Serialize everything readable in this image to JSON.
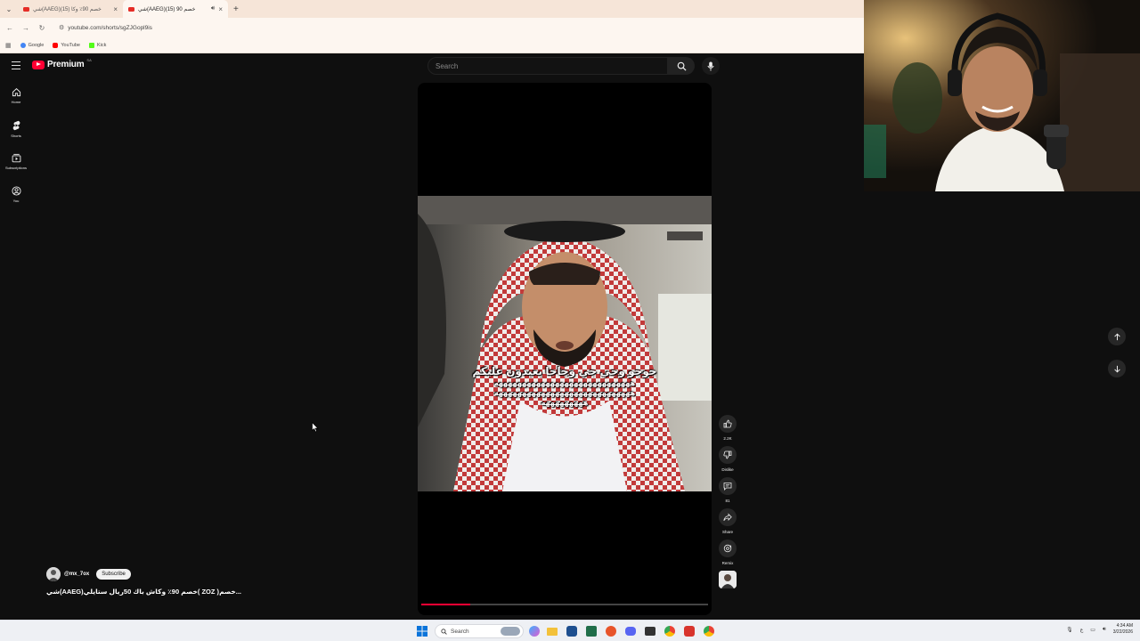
{
  "browser": {
    "tabs": [
      {
        "title": "شي(AAEG)خصم 90٪ وكا (15)",
        "active": false
      },
      {
        "title": "شي(AAEG)خصم 90 (15)",
        "active": true
      }
    ],
    "new_tab_symbol": "+",
    "url": "youtube.com/shorts/sgZJGopl9is",
    "bookmarks": [
      {
        "label": "Google",
        "color": "#4285f4"
      },
      {
        "label": "YouTube",
        "color": "#ff0000"
      },
      {
        "label": "Kick",
        "color": "#53fc18"
      }
    ]
  },
  "youtube": {
    "logo_text": "Premium",
    "country_code": "SA",
    "search_placeholder": "Search",
    "sidebar": [
      {
        "label": "Home",
        "icon": "home-icon"
      },
      {
        "label": "Shorts",
        "icon": "shorts-icon"
      },
      {
        "label": "Subscriptions",
        "icon": "subscriptions-icon"
      },
      {
        "label": "You",
        "icon": "you-icon"
      }
    ],
    "video": {
      "caption_line1": "جوجو وجي جي وجاجا يعيدون عليكم",
      "caption_line2": "هههههههههههههههههههههههههههههه",
      "caption_line3": "هههههههههههههههههههههههههههههه",
      "caption_line4": "هههههههههه",
      "progress": 0.17
    },
    "actions": {
      "like_count": "2.2K",
      "dislike_label": "Dislike",
      "comment_count": "81",
      "share_label": "Share",
      "remix_label": "Remix"
    },
    "channel": {
      "handle": "@mx_7ox",
      "subscribe_label": "Subscribe"
    },
    "video_title": "شي(AAEG)خصم 90٪ وكاش باك 50ريال  ستايلي( ZOZ )خصم..."
  },
  "taskbar": {
    "search_label": "Search",
    "time": "4:34 AM",
    "date": "3/22/2026",
    "lang": "ع"
  },
  "colors": {
    "accent": "#ff0033",
    "page_bg": "#0f0f0f",
    "browser_chrome": "#fdf6f0"
  }
}
